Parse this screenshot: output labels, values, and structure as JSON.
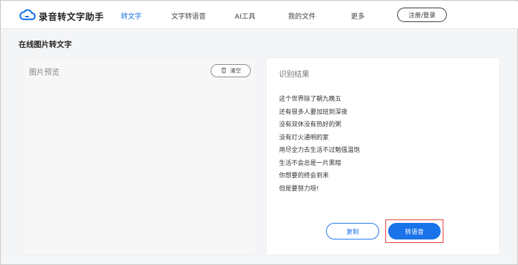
{
  "app": {
    "name": "录音转文字助手",
    "brand_color": "#1a73e8",
    "logo_icon": "cloud-icon"
  },
  "nav": {
    "items": [
      {
        "label": "转文字",
        "active": true
      },
      {
        "label": "文字转语音",
        "active": false
      },
      {
        "label": "AI工具",
        "active": false
      },
      {
        "label": "我的文件",
        "active": false
      },
      {
        "label": "更多",
        "active": false
      }
    ],
    "login_label": "注册/登录"
  },
  "page": {
    "title": "在线图片转文字"
  },
  "preview": {
    "title": "图片预览",
    "clear_label": "清空",
    "clear_icon": "trash-icon"
  },
  "result": {
    "title": "识别结果",
    "lines": [
      "这个世界除了朝九晚五",
      "还有很多人要加班到深夜",
      "没有双休没有热好的粥",
      "没有灯火通明的家",
      "用尽全力去生活不过勉强温饱",
      "生活不会总是一片黑暗",
      "你想要的终会到来",
      "但是要努力呀!"
    ],
    "copy_label": "复制",
    "speech_label": "转语音",
    "highlight_color": "#e53935"
  }
}
